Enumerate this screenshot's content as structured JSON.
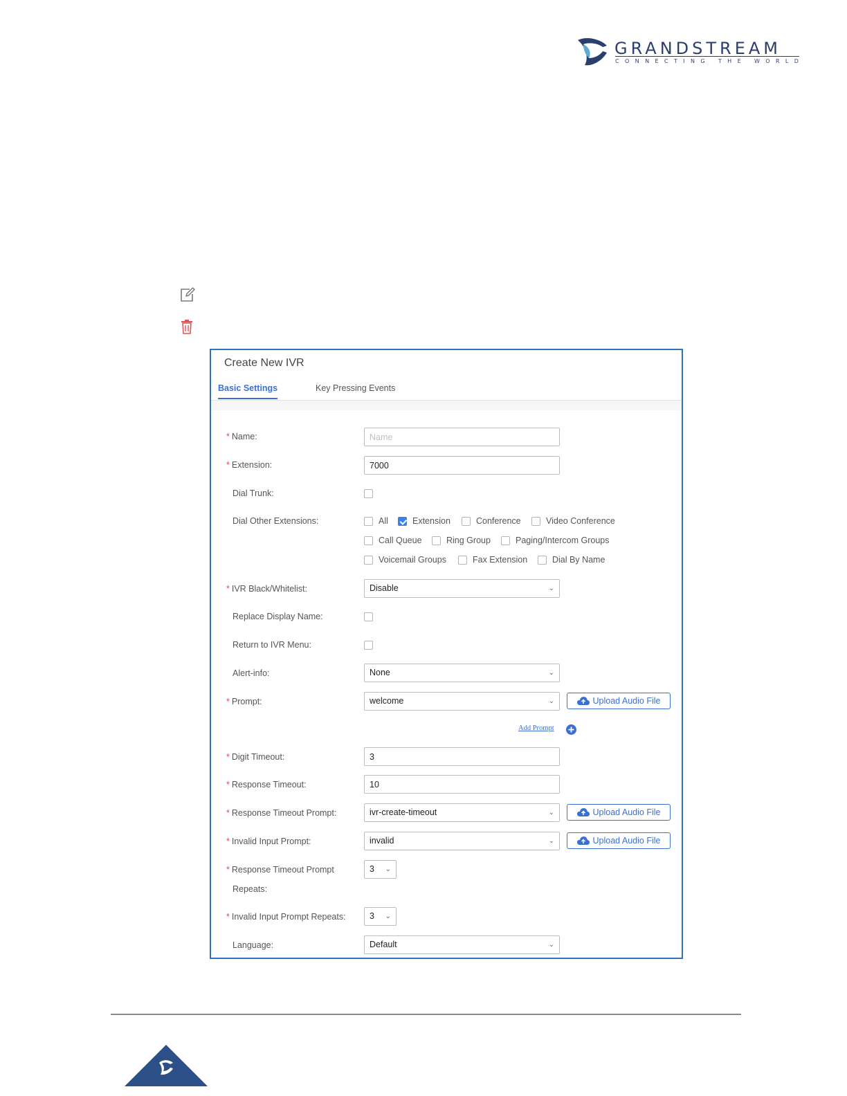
{
  "brand": {
    "name": "GRANDSTREAM",
    "tagline": "CONNECTING THE WORLD",
    "color": "#2b3f6e"
  },
  "icons": {
    "edit": "edit-icon",
    "delete": "delete-icon",
    "upload": "cloud-upload-icon",
    "add": "plus-circle-icon",
    "chevron": "chevron-down-icon"
  },
  "dialog": {
    "title": "Create New IVR",
    "tabs": [
      {
        "label": "Basic Settings",
        "active": true
      },
      {
        "label": "Key Pressing Events",
        "active": false
      }
    ],
    "fields": {
      "name": {
        "label": "Name",
        "value": "",
        "placeholder": "Name"
      },
      "extension": {
        "label": "Extension",
        "value": "7000"
      },
      "dial_trunk": {
        "label": "Dial Trunk",
        "checked": false
      },
      "dial_other_extensions": {
        "label": "Dial Other Extensions",
        "options": [
          {
            "label": "All",
            "checked": false
          },
          {
            "label": "Extension",
            "checked": true
          },
          {
            "label": "Conference",
            "checked": false
          },
          {
            "label": "Video Conference",
            "checked": false
          },
          {
            "label": "Call Queue",
            "checked": false
          },
          {
            "label": "Ring Group",
            "checked": false
          },
          {
            "label": "Paging/Intercom Groups",
            "checked": false
          },
          {
            "label": "Voicemail Groups",
            "checked": false
          },
          {
            "label": "Fax Extension",
            "checked": false
          },
          {
            "label": "Dial By Name",
            "checked": false
          }
        ]
      },
      "ivr_blackwhitelist": {
        "label": "IVR Black/Whitelist",
        "value": "Disable"
      },
      "replace_display_name": {
        "label": "Replace Display Name",
        "checked": false
      },
      "return_to_ivr_menu": {
        "label": "Return to IVR Menu",
        "checked": false
      },
      "alert_info": {
        "label": "Alert-info",
        "value": "None"
      },
      "prompt": {
        "label": "Prompt",
        "value": "welcome"
      },
      "add_prompt": {
        "label": "Add Prompt"
      },
      "digit_timeout": {
        "label": "Digit Timeout",
        "value": "3"
      },
      "response_timeout": {
        "label": "Response Timeout",
        "value": "10"
      },
      "response_timeout_prompt": {
        "label": "Response Timeout Prompt",
        "value": "ivr-create-timeout"
      },
      "invalid_input_prompt": {
        "label": "Invalid Input Prompt",
        "value": "invalid"
      },
      "response_timeout_prompt_repeats": {
        "label_line1": "Response Timeout Prompt",
        "label_line2": "Repeats",
        "value": "3"
      },
      "invalid_input_prompt_repeats": {
        "label": "Invalid Input Prompt Repeats",
        "value": "3"
      },
      "language": {
        "label": "Language",
        "value": "Default"
      }
    },
    "upload_label": "Upload Audio File",
    "required_mark": "*",
    "colon": ":",
    "accent_color": "#3b6fd0"
  }
}
